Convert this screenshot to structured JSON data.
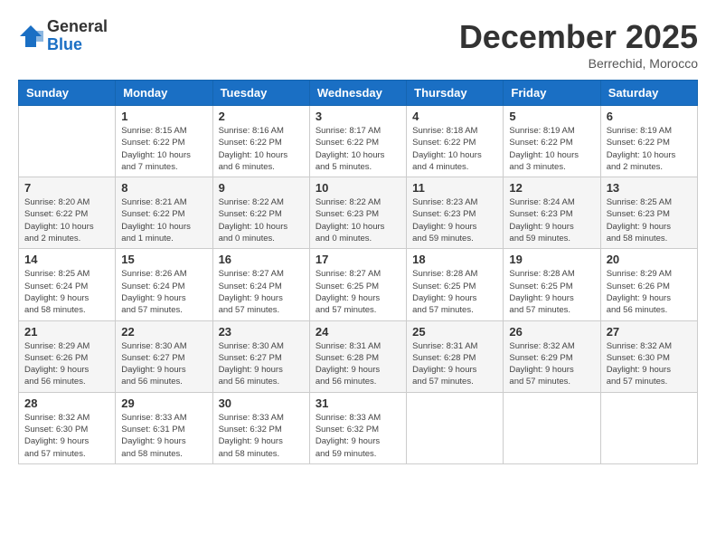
{
  "header": {
    "logo_line1": "General",
    "logo_line2": "Blue",
    "month_title": "December 2025",
    "subtitle": "Berrechid, Morocco"
  },
  "weekdays": [
    "Sunday",
    "Monday",
    "Tuesday",
    "Wednesday",
    "Thursday",
    "Friday",
    "Saturday"
  ],
  "weeks": [
    [
      {
        "day": "",
        "info": ""
      },
      {
        "day": "1",
        "info": "Sunrise: 8:15 AM\nSunset: 6:22 PM\nDaylight: 10 hours\nand 7 minutes."
      },
      {
        "day": "2",
        "info": "Sunrise: 8:16 AM\nSunset: 6:22 PM\nDaylight: 10 hours\nand 6 minutes."
      },
      {
        "day": "3",
        "info": "Sunrise: 8:17 AM\nSunset: 6:22 PM\nDaylight: 10 hours\nand 5 minutes."
      },
      {
        "day": "4",
        "info": "Sunrise: 8:18 AM\nSunset: 6:22 PM\nDaylight: 10 hours\nand 4 minutes."
      },
      {
        "day": "5",
        "info": "Sunrise: 8:19 AM\nSunset: 6:22 PM\nDaylight: 10 hours\nand 3 minutes."
      },
      {
        "day": "6",
        "info": "Sunrise: 8:19 AM\nSunset: 6:22 PM\nDaylight: 10 hours\nand 2 minutes."
      }
    ],
    [
      {
        "day": "7",
        "info": "Sunrise: 8:20 AM\nSunset: 6:22 PM\nDaylight: 10 hours\nand 2 minutes."
      },
      {
        "day": "8",
        "info": "Sunrise: 8:21 AM\nSunset: 6:22 PM\nDaylight: 10 hours\nand 1 minute."
      },
      {
        "day": "9",
        "info": "Sunrise: 8:22 AM\nSunset: 6:22 PM\nDaylight: 10 hours\nand 0 minutes."
      },
      {
        "day": "10",
        "info": "Sunrise: 8:22 AM\nSunset: 6:23 PM\nDaylight: 10 hours\nand 0 minutes."
      },
      {
        "day": "11",
        "info": "Sunrise: 8:23 AM\nSunset: 6:23 PM\nDaylight: 9 hours\nand 59 minutes."
      },
      {
        "day": "12",
        "info": "Sunrise: 8:24 AM\nSunset: 6:23 PM\nDaylight: 9 hours\nand 59 minutes."
      },
      {
        "day": "13",
        "info": "Sunrise: 8:25 AM\nSunset: 6:23 PM\nDaylight: 9 hours\nand 58 minutes."
      }
    ],
    [
      {
        "day": "14",
        "info": "Sunrise: 8:25 AM\nSunset: 6:24 PM\nDaylight: 9 hours\nand 58 minutes."
      },
      {
        "day": "15",
        "info": "Sunrise: 8:26 AM\nSunset: 6:24 PM\nDaylight: 9 hours\nand 57 minutes."
      },
      {
        "day": "16",
        "info": "Sunrise: 8:27 AM\nSunset: 6:24 PM\nDaylight: 9 hours\nand 57 minutes."
      },
      {
        "day": "17",
        "info": "Sunrise: 8:27 AM\nSunset: 6:25 PM\nDaylight: 9 hours\nand 57 minutes."
      },
      {
        "day": "18",
        "info": "Sunrise: 8:28 AM\nSunset: 6:25 PM\nDaylight: 9 hours\nand 57 minutes."
      },
      {
        "day": "19",
        "info": "Sunrise: 8:28 AM\nSunset: 6:25 PM\nDaylight: 9 hours\nand 57 minutes."
      },
      {
        "day": "20",
        "info": "Sunrise: 8:29 AM\nSunset: 6:26 PM\nDaylight: 9 hours\nand 56 minutes."
      }
    ],
    [
      {
        "day": "21",
        "info": "Sunrise: 8:29 AM\nSunset: 6:26 PM\nDaylight: 9 hours\nand 56 minutes."
      },
      {
        "day": "22",
        "info": "Sunrise: 8:30 AM\nSunset: 6:27 PM\nDaylight: 9 hours\nand 56 minutes."
      },
      {
        "day": "23",
        "info": "Sunrise: 8:30 AM\nSunset: 6:27 PM\nDaylight: 9 hours\nand 56 minutes."
      },
      {
        "day": "24",
        "info": "Sunrise: 8:31 AM\nSunset: 6:28 PM\nDaylight: 9 hours\nand 56 minutes."
      },
      {
        "day": "25",
        "info": "Sunrise: 8:31 AM\nSunset: 6:28 PM\nDaylight: 9 hours\nand 57 minutes."
      },
      {
        "day": "26",
        "info": "Sunrise: 8:32 AM\nSunset: 6:29 PM\nDaylight: 9 hours\nand 57 minutes."
      },
      {
        "day": "27",
        "info": "Sunrise: 8:32 AM\nSunset: 6:30 PM\nDaylight: 9 hours\nand 57 minutes."
      }
    ],
    [
      {
        "day": "28",
        "info": "Sunrise: 8:32 AM\nSunset: 6:30 PM\nDaylight: 9 hours\nand 57 minutes."
      },
      {
        "day": "29",
        "info": "Sunrise: 8:33 AM\nSunset: 6:31 PM\nDaylight: 9 hours\nand 58 minutes."
      },
      {
        "day": "30",
        "info": "Sunrise: 8:33 AM\nSunset: 6:32 PM\nDaylight: 9 hours\nand 58 minutes."
      },
      {
        "day": "31",
        "info": "Sunrise: 8:33 AM\nSunset: 6:32 PM\nDaylight: 9 hours\nand 59 minutes."
      },
      {
        "day": "",
        "info": ""
      },
      {
        "day": "",
        "info": ""
      },
      {
        "day": "",
        "info": ""
      }
    ]
  ]
}
